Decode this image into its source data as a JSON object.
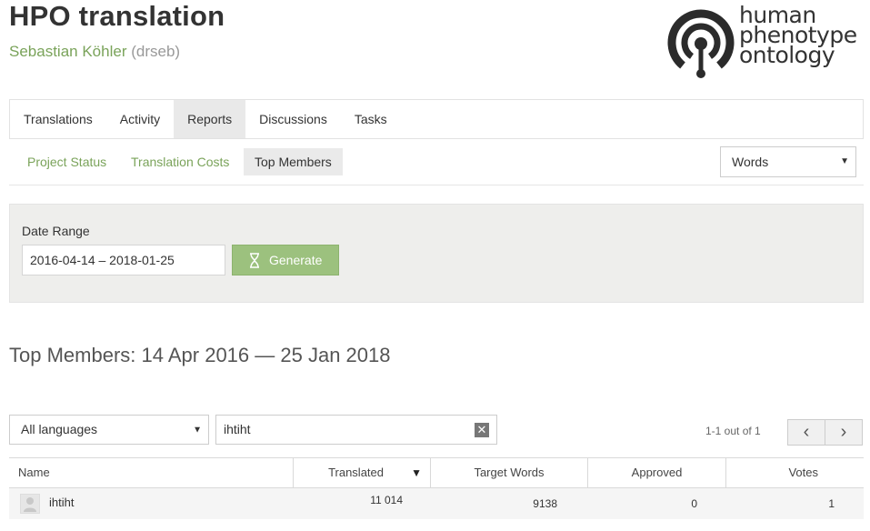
{
  "header": {
    "title": "HPO translation",
    "user_name": "Sebastian Köhler",
    "user_handle": "(drseb)"
  },
  "logo": {
    "line1": "human",
    "line2": "phenotype",
    "line3": "ontology",
    "icon": "hpo-logo-icon"
  },
  "main_nav": {
    "tabs": [
      {
        "label": "Translations",
        "active": false
      },
      {
        "label": "Activity",
        "active": false
      },
      {
        "label": "Reports",
        "active": true
      },
      {
        "label": "Discussions",
        "active": false
      },
      {
        "label": "Tasks",
        "active": false
      }
    ]
  },
  "sub_nav": {
    "tabs": [
      {
        "label": "Project Status",
        "active": false
      },
      {
        "label": "Translation Costs",
        "active": false
      },
      {
        "label": "Top Members",
        "active": true
      }
    ],
    "unit_select": "Words"
  },
  "date_panel": {
    "label": "Date Range",
    "date_range_value": "2016-04-14 – 2018-01-25",
    "generate_label": "Generate",
    "generate_icon": "hourglass-icon"
  },
  "report": {
    "heading": "Top Members: 14 Apr 2016 — 25 Jan 2018"
  },
  "filters": {
    "language_select": "All languages",
    "search_value": "ihtiht",
    "clear_icon": "clear-icon"
  },
  "pager": {
    "text": "1-1 out of 1",
    "prev": "‹",
    "next": "›"
  },
  "table": {
    "columns": [
      "Name",
      "Translated",
      "Target Words",
      "Approved",
      "Votes"
    ],
    "sorted_column": "Translated",
    "sort_indicator": "▼",
    "rows": [
      {
        "name": "ihtiht",
        "translated": "11 014",
        "target_words": "9138",
        "approved": "0",
        "votes": "1"
      }
    ]
  },
  "colors": {
    "accent_green": "#7aa35a",
    "button_green": "#9cc17e",
    "panel_bg": "#eeeeec"
  }
}
